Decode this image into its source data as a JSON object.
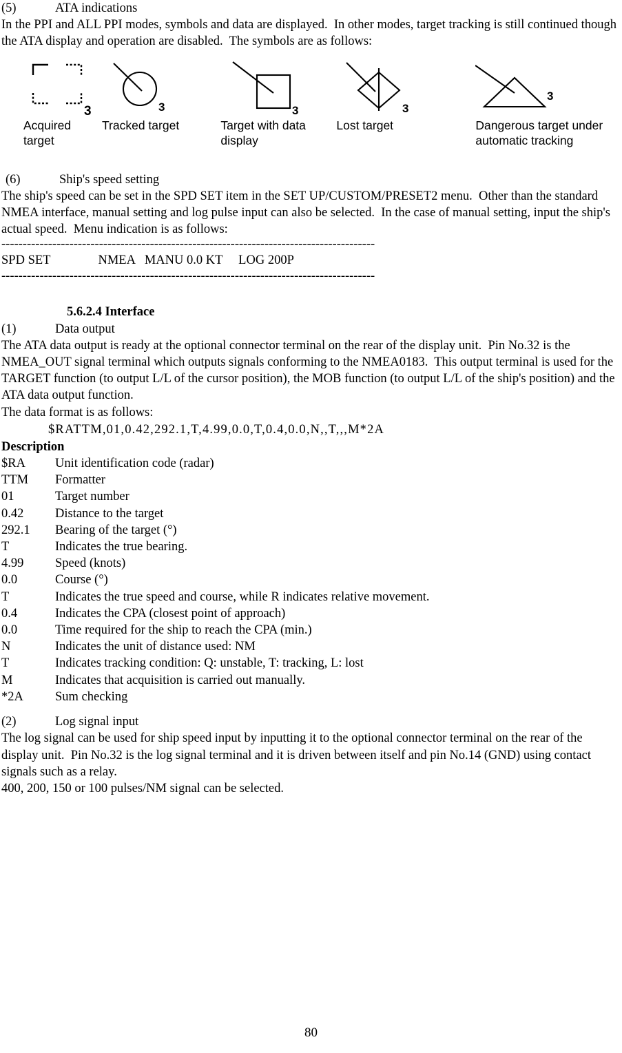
{
  "section_5": {
    "number": "(5)",
    "title": "ATA indications",
    "paragraph": "In the PPI and ALL PPI modes, symbols and data are displayed.  In other modes, target tracking is still continued though the ATA display and operation are disabled.  The symbols are as follows:"
  },
  "symbols": [
    {
      "id": "acquired-target",
      "shape": "dashed-corner-square",
      "target_number": "3",
      "label": "Acquired target"
    },
    {
      "id": "tracked-target",
      "shape": "circle-with-vector",
      "target_number": "3",
      "label": "Tracked target"
    },
    {
      "id": "target-with-data",
      "shape": "square-with-vector",
      "target_number": "3",
      "label": "Target with data display"
    },
    {
      "id": "lost-target",
      "shape": "diamond-with-bar",
      "target_number": "3",
      "label": "Lost target"
    },
    {
      "id": "dangerous-target",
      "shape": "triangle-with-vector",
      "target_number": "3",
      "label": "Dangerous target under automatic tracking"
    }
  ],
  "section_6": {
    "number": "(6)",
    "title": "Ship's speed setting",
    "paragraph": "The ship's speed can be set in the SPD SET item in the SET UP/CUSTOM/PRESET2 menu.  Other than the standard NMEA interface, manual setting and log pulse input can also be selected.  In the case of manual setting, input the ship's actual speed.  Menu indication is as follows:",
    "menu_box": {
      "rule": "----------------------------------------------------------------------------------------",
      "line": "SPD SET               NMEA   MANU 0.0 KT     LOG 200P"
    }
  },
  "interface_section": {
    "heading": "5.6.2.4  Interface",
    "item1": {
      "number": "(1)",
      "title": "Data output",
      "paragraph1": "The ATA data output is ready at the optional connector terminal on the rear of the display unit.  Pin No.32 is the NMEA_OUT signal terminal which outputs signals conforming to the NMEA0183.  This output terminal is used for the TARGET function (to output L/L of the cursor position), the MOB function (to output L/L of the ship's position) and the ATA data output function.",
      "paragraph2": "The data format is as follows:",
      "nmea_sentence": "$RATTM,01,0.42,292.1,T,4.99,0.0,T,0.4,0.0,N,,T,,,M*2A",
      "description_heading": "Description",
      "description_rows": [
        {
          "key": "$RA",
          "value": "Unit identification code (radar)"
        },
        {
          "key": "TTM",
          "value": "Formatter"
        },
        {
          "key": "01",
          "value": "Target number"
        },
        {
          "key": "0.42",
          "value": "Distance to the target"
        },
        {
          "key": "292.1",
          "value": "Bearing of the target (°)"
        },
        {
          "key": "T",
          "value": "Indicates the true bearing."
        },
        {
          "key": "4.99",
          "value": "Speed (knots)"
        },
        {
          "key": "0.0",
          "value": "Course (°)"
        },
        {
          "key": "T",
          "value": "Indicates the true speed and course, while R indicates relative movement."
        },
        {
          "key": "0.4",
          "value": "Indicates the CPA (closest point of approach)"
        },
        {
          "key": "0.0",
          "value": "Time required for the ship to reach the CPA (min.)"
        },
        {
          "key": "N",
          "value": "Indicates the unit of distance used: NM"
        },
        {
          "key": "T",
          "value": "Indicates tracking condition:  Q: unstable, T: tracking, L: lost"
        },
        {
          "key": "M",
          "value": "Indicates that acquisition is carried out manually."
        },
        {
          "key": "*2A",
          "value": "Sum checking"
        }
      ]
    },
    "item2": {
      "number": "(2)",
      "title": "Log signal input",
      "paragraph1": "The log signal can be used for ship speed input by inputting it to the optional connector terminal on the rear of the display unit.  Pin No.32 is the log signal terminal and it is driven between itself and pin No.14 (GND) using contact signals such as a relay.",
      "paragraph2": "400, 200, 150 or 100 pulses/NM signal can be selected."
    }
  },
  "footer": {
    "page_number": "80"
  }
}
